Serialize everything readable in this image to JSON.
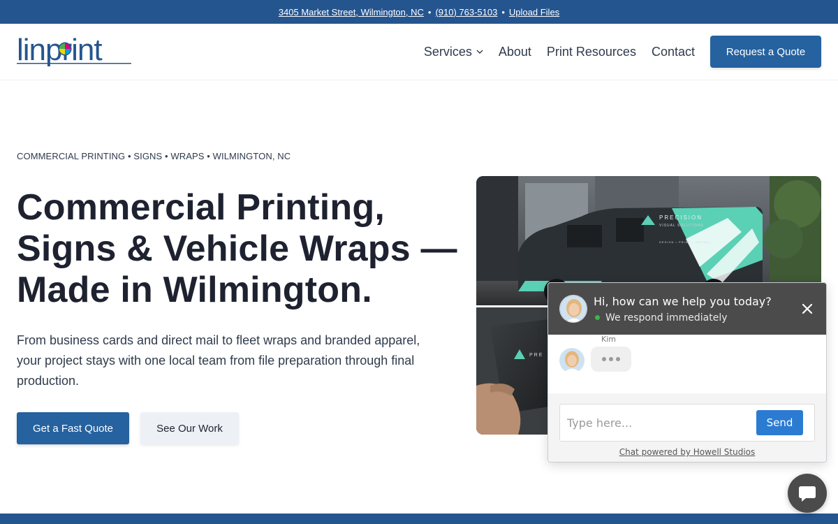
{
  "topbar": {
    "address": "3405 Market Street, Wilmington, NC",
    "bullet1": "•",
    "phone": "(910) 763-5103",
    "bullet2": "•",
    "upload": "Upload Files"
  },
  "header": {
    "logo_text": "linprint",
    "nav": {
      "services": "Services",
      "about": "About",
      "resources": "Print Resources",
      "contact": "Contact"
    },
    "cta": "Request a Quote"
  },
  "hero": {
    "eyebrow": "COMMERCIAL PRINTING • SIGNS • WRAPS • WILMINGTON, NC",
    "title": "Commercial Printing, Signs & Vehicle Wraps —Made in Wilmington.",
    "subtitle": "From business cards and direct mail to fleet wraps and branded apparel, your project stays with one local team from file preparation through final production.",
    "primary_button": "Get a Fast Quote",
    "secondary_button": "See Our Work",
    "van_brand_line1": "PRECISION",
    "van_brand_line2": "VISUAL SOLUTIONS",
    "van_tagline": "DESIGN • PRINT • INSTALL",
    "card_brand": "PRE"
  },
  "chat": {
    "title": "Hi, how can we help you today?",
    "status": "We respond immediately",
    "agent_name": "Kim",
    "input_placeholder": "Type here...",
    "send_label": "Send",
    "powered_by": "Chat powered by Howell Studios"
  },
  "colors": {
    "brand_blue": "#25558f",
    "button_blue": "#25629f",
    "chat_header": "#4b4b4b",
    "send_blue": "#2b7bd3",
    "status_green": "#3cb44b"
  },
  "icons": {
    "nav_dropdown": "chevron-down-icon",
    "chat_close": "close-icon",
    "launcher": "chat-bubble-icon"
  }
}
